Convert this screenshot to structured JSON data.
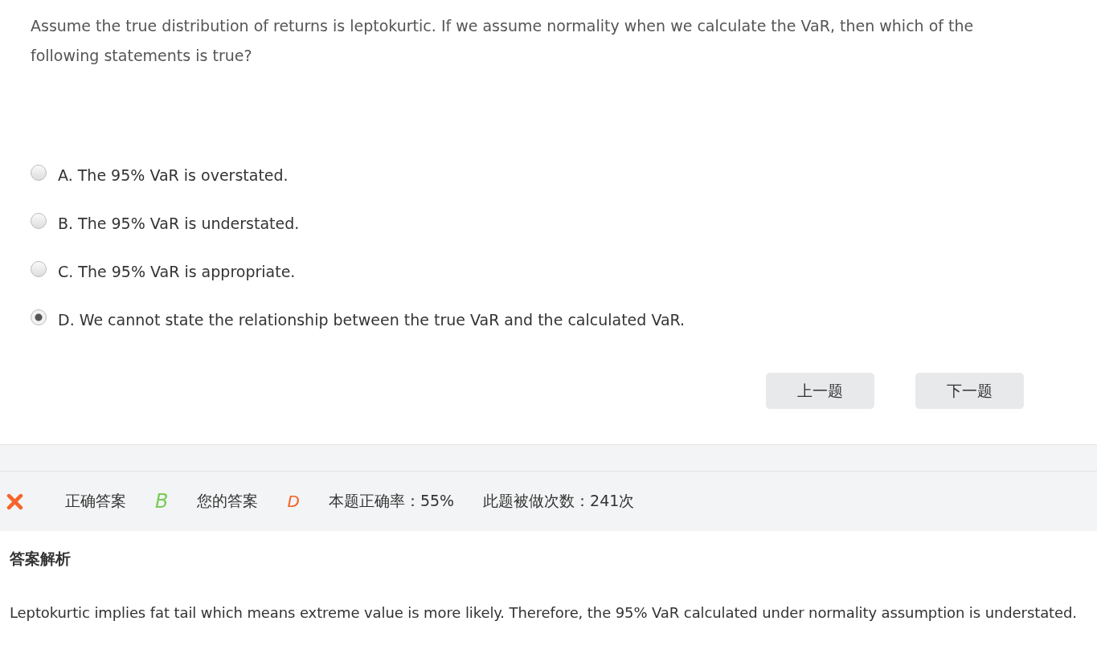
{
  "question": {
    "text": "Assume the true distribution of returns is leptokurtic. If we assume normality when we calculate the VaR, then which of the following statements is true?"
  },
  "options": [
    {
      "label": "A. The 95% VaR is overstated.",
      "selected": false
    },
    {
      "label": "B. The 95% VaR is understated.",
      "selected": false
    },
    {
      "label": "C. The 95% VaR is appropriate.",
      "selected": false
    },
    {
      "label": "D. We cannot state the relationship between the true VaR and the calculated VaR.",
      "selected": true
    }
  ],
  "buttons": [
    {
      "label": "上一题"
    },
    {
      "label": "下一题"
    }
  ],
  "result": {
    "is_correct": false,
    "correct_answer_label": "正确答案",
    "correct_answer": "B",
    "your_answer_label": "您的答案",
    "your_answer": "D",
    "accuracy": "本题正确率：55%",
    "attempts": "此题被做次数：241次"
  },
  "explanation": {
    "heading": "答案解析",
    "text": "Leptokurtic implies fat tail which means extreme value is more likely. Therefore, the 95% VaR calculated under normality assumption is understated."
  }
}
